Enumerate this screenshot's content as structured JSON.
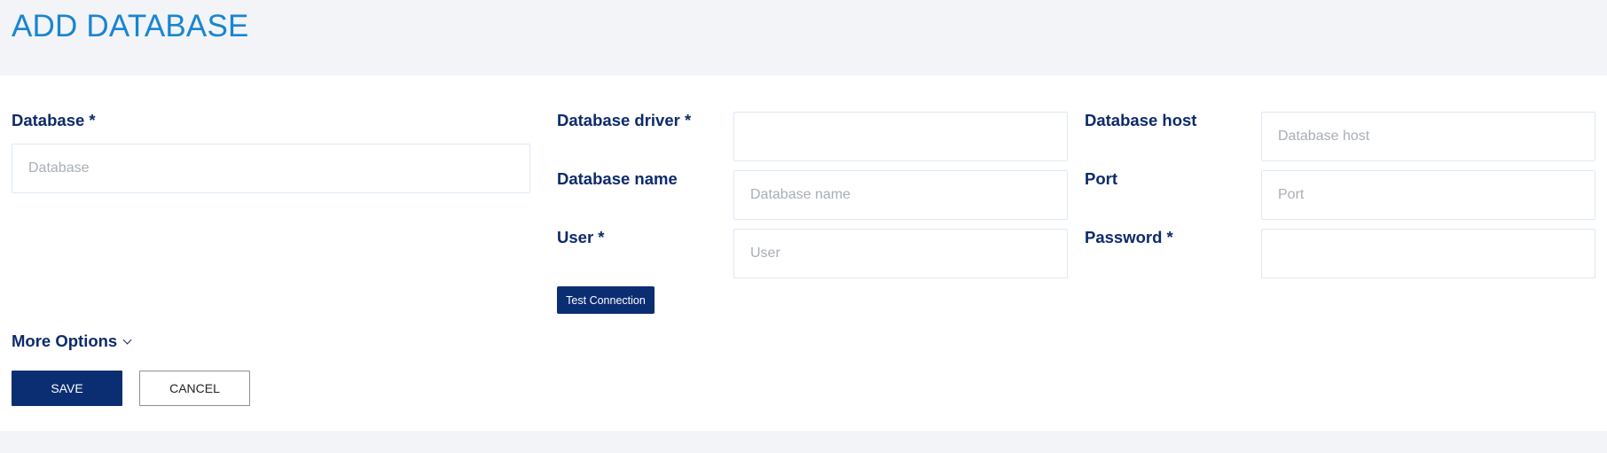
{
  "page": {
    "title": "ADD DATABASE"
  },
  "form": {
    "database": {
      "label": "Database *",
      "placeholder": "Database",
      "value": ""
    },
    "driver": {
      "label": "Database driver *",
      "placeholder": "",
      "value": ""
    },
    "host": {
      "label": "Database host",
      "placeholder": "Database host",
      "value": ""
    },
    "name": {
      "label": "Database name",
      "placeholder": "Database name",
      "value": ""
    },
    "port": {
      "label": "Port",
      "placeholder": "Port",
      "value": ""
    },
    "user": {
      "label": "User *",
      "placeholder": "User",
      "value": ""
    },
    "password": {
      "label": "Password *",
      "placeholder": "",
      "value": ""
    }
  },
  "actions": {
    "test_connection_label": "Test Connection",
    "more_options_label": "More Options",
    "more_options_icon": "chevron-down-icon",
    "save_label": "SAVE",
    "cancel_label": "CANCEL"
  },
  "colors": {
    "title": "#1a85d0",
    "label": "#0d2a6b",
    "primary_button": "#0b2d72",
    "page_background": "#f2f4f8",
    "panel_background": "#ffffff",
    "input_border": "#dde8f5"
  }
}
